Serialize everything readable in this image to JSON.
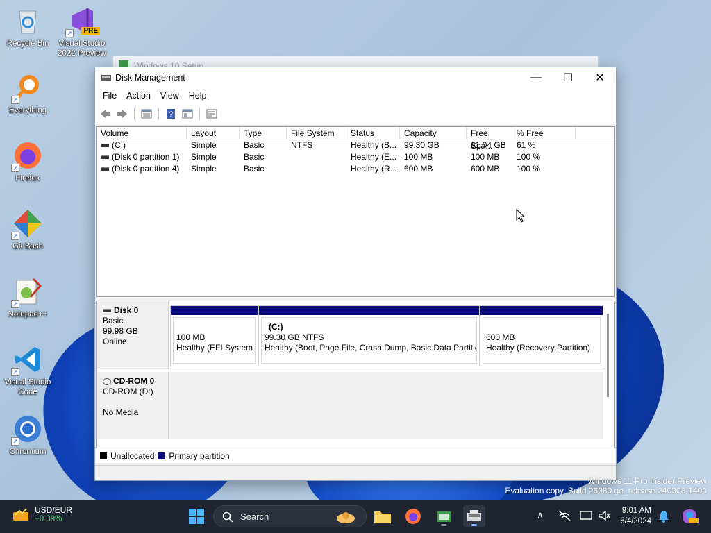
{
  "desktop": {
    "icons": [
      {
        "label": "Recycle Bin"
      },
      {
        "label": "Visual Studio 2022 Preview",
        "badge": "PRE"
      },
      {
        "label": "Everything"
      },
      {
        "label": "Firefox"
      },
      {
        "label": "Git Bash"
      },
      {
        "label": "Notepad++"
      },
      {
        "label": "Visual Studio Code"
      },
      {
        "label": "Chromium"
      }
    ],
    "background_window_title": "Windows 10 Setup",
    "watermark_line1": "Windows 11 Pro Insider Preview",
    "watermark_line2": "Evaluation copy. Build 26080.ge_release.240308-1400"
  },
  "window": {
    "title": "Disk Management",
    "controls": {
      "minimize": "—",
      "maximize": "☐",
      "close": "✕"
    },
    "menu": [
      "File",
      "Action",
      "View",
      "Help"
    ],
    "toolbar_icons": [
      "back-icon",
      "forward-icon",
      "properties-icon",
      "help-icon",
      "console-icon",
      "list-icon"
    ]
  },
  "volume_list": {
    "columns": [
      "Volume",
      "Layout",
      "Type",
      "File System",
      "Status",
      "Capacity",
      "Free Spa...",
      "% Free"
    ],
    "rows": [
      [
        "(C:)",
        "Simple",
        "Basic",
        "NTFS",
        "Healthy (B...",
        "99.30 GB",
        "61.04 GB",
        "61 %"
      ],
      [
        "(Disk 0 partition 1)",
        "Simple",
        "Basic",
        "",
        "Healthy (E...",
        "100 MB",
        "100 MB",
        "100 %"
      ],
      [
        "(Disk 0 partition 4)",
        "Simple",
        "Basic",
        "",
        "Healthy (R...",
        "600 MB",
        "600 MB",
        "100 %"
      ]
    ]
  },
  "disks": {
    "disk0": {
      "name": "Disk 0",
      "type": "Basic",
      "size": "99.98 GB",
      "state": "Online",
      "partitions": [
        {
          "title": "",
          "size": "100 MB",
          "desc": "Healthy (EFI System Partition)"
        },
        {
          "title": "(C:)",
          "size": "99.30 GB NTFS",
          "desc": "Healthy (Boot, Page File, Crash Dump, Basic Data Partition)"
        },
        {
          "title": "",
          "size": "600 MB",
          "desc": "Healthy (Recovery Partition)"
        }
      ]
    },
    "cdrom0": {
      "name": "CD-ROM 0",
      "drive": "CD-ROM (D:)",
      "media": "No Media"
    }
  },
  "legend": {
    "unallocated": "Unallocated",
    "primary": "Primary partition",
    "unallocated_color": "#000000",
    "primary_color": "#0a0a7a"
  },
  "taskbar": {
    "ticker_symbol": "USD/EUR",
    "ticker_change": "+0.39%",
    "search_placeholder": "Search",
    "time": "9:01 AM",
    "date": "6/4/2024"
  }
}
